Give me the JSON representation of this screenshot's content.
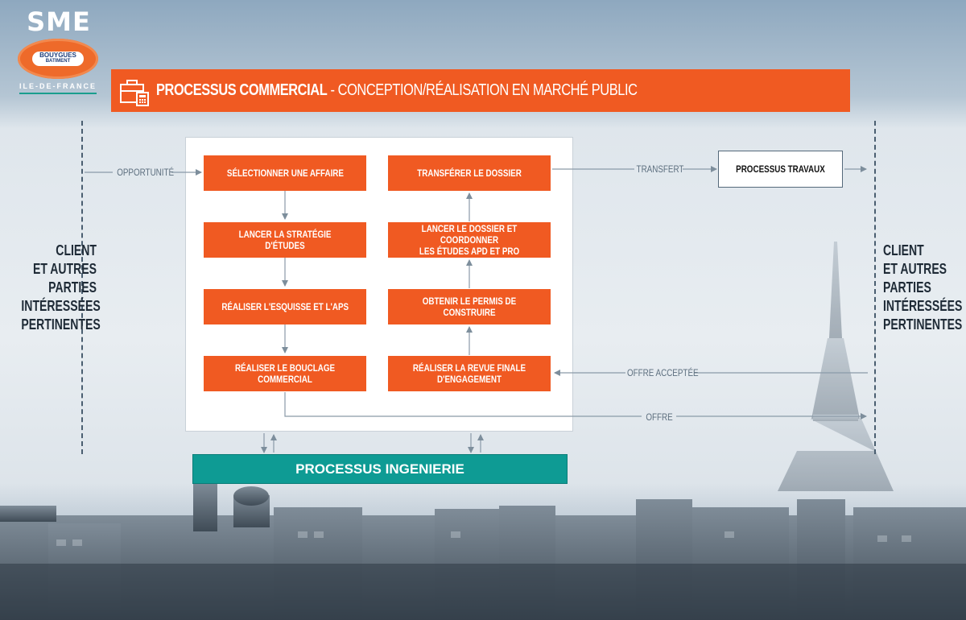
{
  "logo": {
    "brand": "SME",
    "badge_line1": "BOUYGUES",
    "badge_line2": "BATIMENT",
    "region": "ILE-DE-FRANCE"
  },
  "header": {
    "title_bold": "PROCESSUS COMMERCIAL",
    "title_sep": " - ",
    "title_rest": "CONCEPTION/RÉALISATION EN MARCHÉ PUBLIC",
    "icon": "briefcase-calculator-icon"
  },
  "sides": {
    "left_text": "CLIENT\nET AUTRES\nPARTIES\nINTÉRESSÉES\nPERTINENTES",
    "right_text": "CLIENT\nET AUTRES\nPARTIES\nINTÉRESSÉES\nPERTINENTES"
  },
  "steps_left": [
    "SÉLECTIONNER UNE AFFAIRE",
    "LANCER LA STRATÉGIE D'ÉTUDES",
    "RÉALISER L'ESQUISSE ET L'APS",
    "RÉALISER LE BOUCLAGE COMMERCIAL"
  ],
  "steps_right": [
    "TRANSFÉRER LE DOSSIER",
    "LANCER LE DOSSIER ET COORDONNER\nLES ÉTUDES APD ET PRO",
    "OBTENIR LE PERMIS DE CONSTRUIRE",
    "RÉALISER LA REVUE FINALE D'ENGAGEMENT"
  ],
  "flows": {
    "opportunite": "OPPORTUNITÉ",
    "transfert": "TRANSFERT",
    "offre_acceptee": "OFFRE ACCEPTÉE",
    "offre": "OFFRE"
  },
  "boxes": {
    "travaux": "PROCESSUS TRAVAUX",
    "ingenierie": "PROCESSUS INGENIERIE"
  },
  "colors": {
    "accent": "#f05a22",
    "teal": "#0e9b94",
    "text_dark": "#1e2a36"
  }
}
